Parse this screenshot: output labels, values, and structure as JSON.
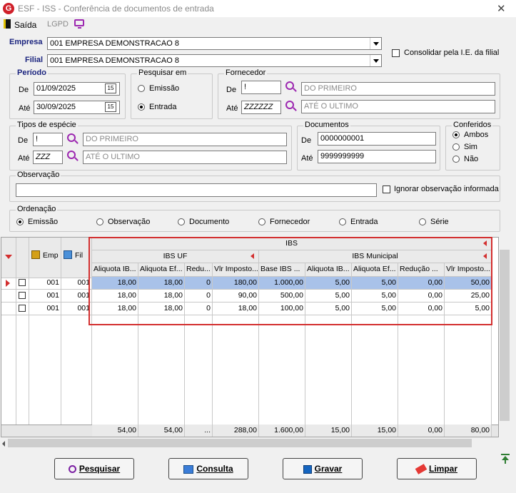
{
  "window": {
    "title": "ESF - ISS - Conferência de documentos de entrada",
    "icon_letter": "G"
  },
  "toolbar": {
    "saida": "Saída",
    "lgpd": "LGPD"
  },
  "empresa": {
    "label": "Empresa",
    "value": "001 EMPRESA DEMONSTRACAO 8"
  },
  "filial": {
    "label": "Filial",
    "value": "001 EMPRESA DEMONSTRACAO 8"
  },
  "consolidar": {
    "label": "Consolidar pela I.E. da filial",
    "checked": false
  },
  "periodo": {
    "title": "Período",
    "de_label": "De",
    "de": "01/09/2025",
    "ate_label": "Até",
    "ate": "30/09/2025",
    "cal": "15"
  },
  "pesquisar_em": {
    "title": "Pesquisar em",
    "options": [
      "Emissão",
      "Entrada"
    ],
    "selected": "Entrada"
  },
  "fornecedor": {
    "title": "Fornecedor",
    "de_label": "De",
    "de_code": "!",
    "de_name": "DO PRIMEIRO",
    "ate_label": "Até",
    "ate_code": "ZZZZZZ",
    "ate_name": "ATÉ O ULTIMO"
  },
  "tipos_especie": {
    "title": "Tipos de espécie",
    "de_label": "De",
    "de_code": "!",
    "de_name": "DO PRIMEIRO",
    "ate_label": "Até",
    "ate_code": "ZZZ",
    "ate_name": "ATÉ O ULTIMO"
  },
  "documentos": {
    "title": "Documentos",
    "de_label": "De",
    "de": "0000000001",
    "ate_label": "Até",
    "ate": "9999999999"
  },
  "conferidos": {
    "title": "Conferidos",
    "options": [
      "Ambos",
      "Sim",
      "Não"
    ],
    "selected": "Ambos"
  },
  "observacao": {
    "title": "Observação",
    "value": "",
    "ignorar_label": "Ignorar observação informada"
  },
  "ordenacao": {
    "title": "Ordenação",
    "options": [
      "Emissão",
      "Observação",
      "Documento",
      "Fornecedor",
      "Entrada",
      "Série"
    ],
    "selected": "Emissão"
  },
  "grid": {
    "col_emp": "Emp",
    "col_fil": "Fil",
    "group_top": "IBS",
    "group_uf": "IBS UF",
    "group_mun": "IBS Municipal",
    "columns": [
      "Aliquota IB...",
      "Aliquota Ef...",
      "Redu...",
      "Vlr Imposto...",
      "Base IBS ...",
      "Aliquota IB...",
      "Aliquota Ef...",
      "Redução ...",
      "Vlr Imposto..."
    ],
    "rows": [
      {
        "emp": "001",
        "fil": "001",
        "values": [
          "18,00",
          "18,00",
          "0",
          "180,00",
          "1.000,00",
          "5,00",
          "5,00",
          "0,00",
          "50,00"
        ],
        "selected": true
      },
      {
        "emp": "001",
        "fil": "001",
        "values": [
          "18,00",
          "18,00",
          "0",
          "90,00",
          "500,00",
          "5,00",
          "5,00",
          "0,00",
          "25,00"
        ],
        "selected": false
      },
      {
        "emp": "001",
        "fil": "001",
        "values": [
          "18,00",
          "18,00",
          "0",
          "18,00",
          "100,00",
          "5,00",
          "5,00",
          "0,00",
          "5,00"
        ],
        "selected": false
      }
    ],
    "totals": [
      "54,00",
      "54,00",
      "...",
      "288,00",
      "1.600,00",
      "15,00",
      "15,00",
      "0,00",
      "80,00"
    ]
  },
  "buttons": {
    "pesquisar": "Pesquisar",
    "consulta": "Consulta",
    "gravar": "Gravar",
    "limpar": "Limpar"
  },
  "colors": {
    "highlight": "#d32f2f",
    "accent": "#9c27b0",
    "label_blue": "#1a237e",
    "selected_row": "#a9c2e9"
  }
}
